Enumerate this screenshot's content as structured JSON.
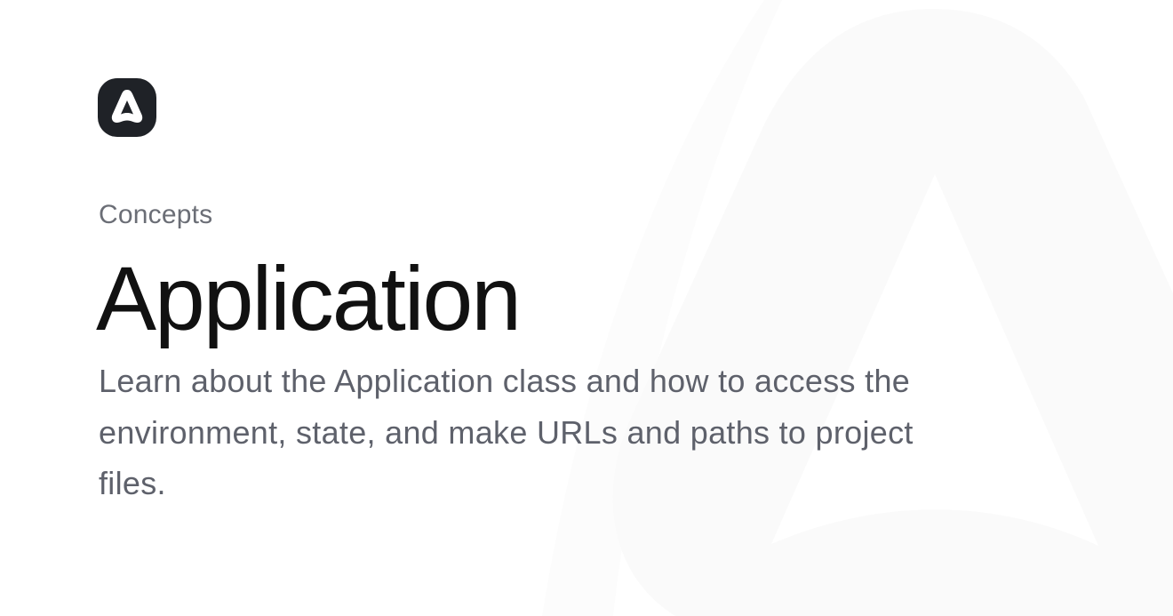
{
  "brand": {
    "logo_icon": "adonisjs-logo-icon",
    "logo_bg_color": "#1f2227",
    "logo_fg_color": "#ffffff",
    "watermark_icon": "adonisjs-watermark-icon",
    "watermark_color": "#fafafa"
  },
  "page": {
    "category": "Concepts",
    "title": "Application",
    "description": "Learn about the Application class and how to access the environment, state, and make URLs and paths to project files."
  },
  "colors": {
    "background": "#ffffff",
    "title": "#111111",
    "text_muted": "#5e616b"
  }
}
